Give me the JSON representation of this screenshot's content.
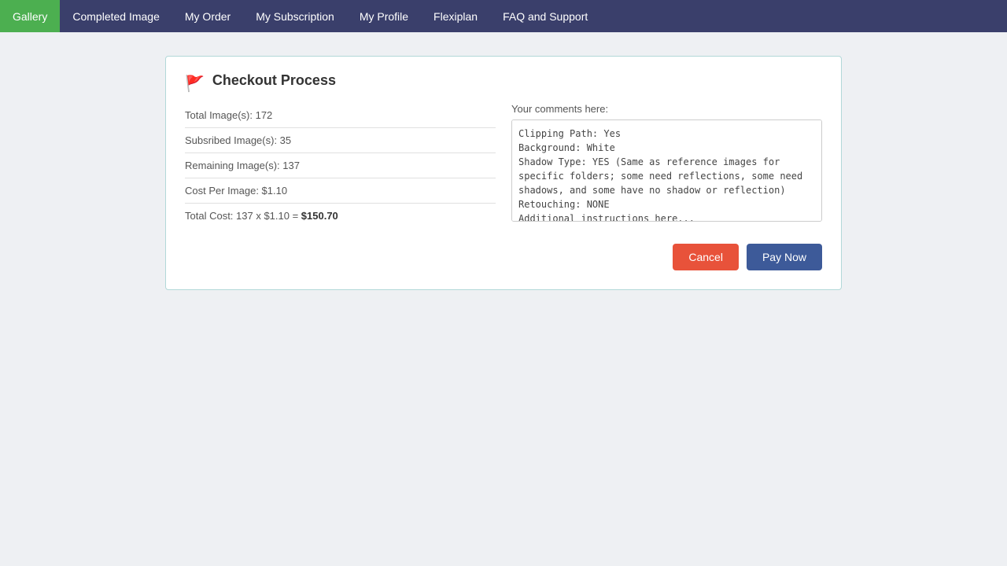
{
  "nav": {
    "items": [
      {
        "label": "Gallery",
        "active": true
      },
      {
        "label": "Completed Image",
        "active": false
      },
      {
        "label": "My Order",
        "active": false
      },
      {
        "label": "My Subscription",
        "active": false
      },
      {
        "label": "My Profile",
        "active": false
      },
      {
        "label": "Flexiplan",
        "active": false
      },
      {
        "label": "FAQ and Support",
        "active": false
      }
    ]
  },
  "checkout": {
    "title": "Checkout Process",
    "flag_icon": "🚩",
    "rows": [
      {
        "label": "Total Image(s): 172"
      },
      {
        "label": "Subsribed Image(s): 35"
      },
      {
        "label": "Remaining Image(s): 137"
      },
      {
        "label": "Cost Per Image: $1.10"
      },
      {
        "label": "Total Cost: 137 x $1.10 = "
      }
    ],
    "total_cost_prefix": "Total Cost: 137 x $1.10 = ",
    "total_amount": "$150.70",
    "comments_label": "Your comments here:",
    "comments_text": "Clipping Path: Yes\nBackground: White\nShadow Type: YES (Same as reference images for specific folders; some need reflections, some need shadows, and some have no shadow or reflection)\nRetouching: NONE\n...",
    "cancel_label": "Cancel",
    "pay_label": "Pay Now"
  }
}
